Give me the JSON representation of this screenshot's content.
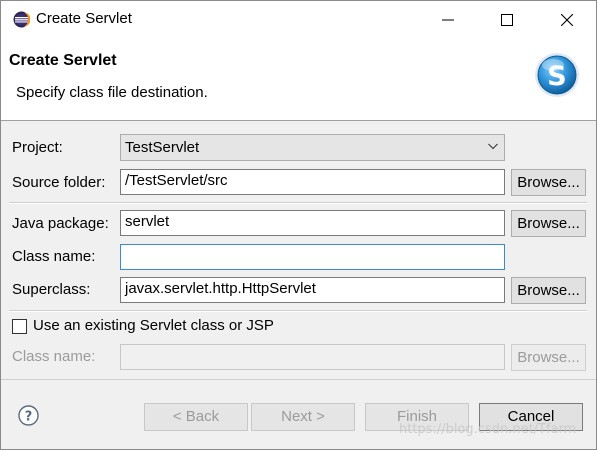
{
  "window": {
    "title": "Create Servlet"
  },
  "banner": {
    "title": "Create Servlet",
    "description": "Specify class file destination.",
    "logo_letter": "S"
  },
  "form": {
    "project_label": "Project:",
    "project_value": "TestServlet",
    "source_folder_label": "Source folder:",
    "source_folder_value": "/TestServlet/src",
    "java_package_label": "Java package:",
    "java_package_value": "servlet",
    "class_name_label": "Class name:",
    "class_name_value": "",
    "superclass_label": "Superclass:",
    "superclass_value": "javax.servlet.http.HttpServlet",
    "browse_label": "Browse...",
    "use_existing_label": "Use an existing Servlet class or JSP",
    "use_existing_checked": false,
    "existing_class_name_label": "Class name:"
  },
  "buttons": {
    "back": "< Back",
    "next": "Next >",
    "finish": "Finish",
    "cancel": "Cancel"
  },
  "watermark": "https://blog.csdn.net/Tfarm",
  "colors": {
    "accent_border": "#3c8ac8",
    "logo_blue": "#2b8fd6"
  }
}
